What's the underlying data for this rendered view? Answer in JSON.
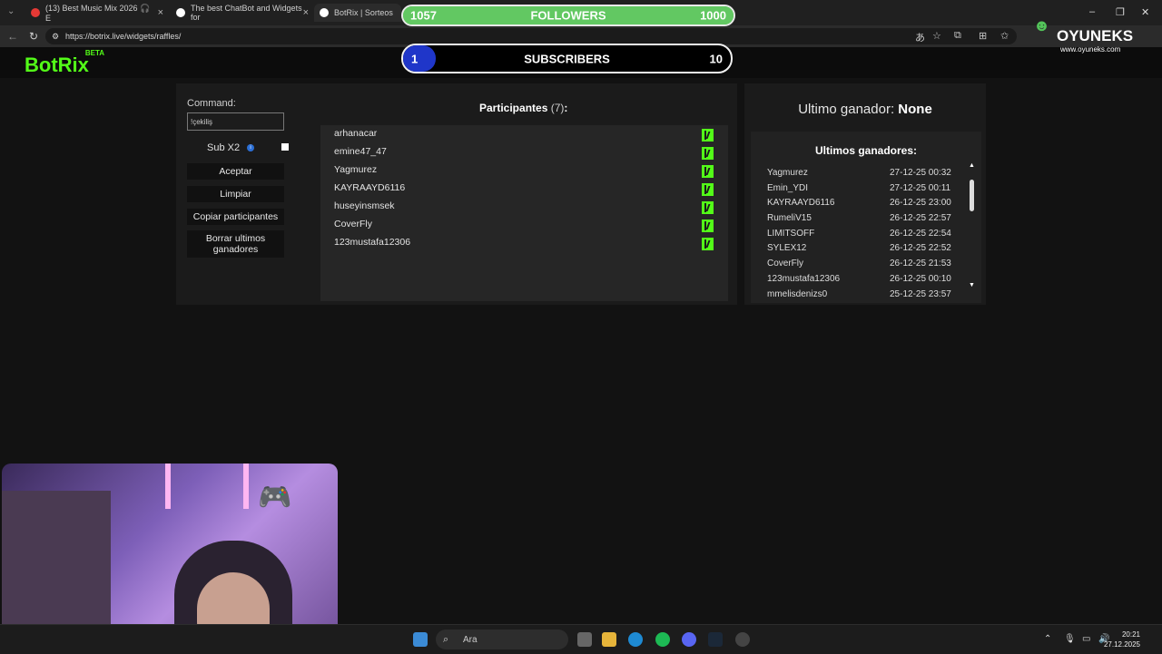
{
  "browser": {
    "tabs": [
      {
        "label": "(13) Best Music Mix 2026 🎧 E",
        "color": "#e53935"
      },
      {
        "label": "The best ChatBot and Widgets for",
        "color": "#ffffff"
      },
      {
        "label": "BotRix | Sorteos",
        "color": "#ffffff"
      }
    ],
    "url": "https://botrix.live/widgets/raffles/"
  },
  "overlay": {
    "followers": {
      "current": "1057",
      "label": "FOLLOWERS",
      "target": "1000",
      "progress": 1.0
    },
    "subscribers": {
      "current": "1",
      "label": "SUBSCRIBERS",
      "target": "10",
      "progress": 0.1
    },
    "watermark": "OYUNEKS",
    "watermark_url": "www.oyuneks.com"
  },
  "app": {
    "logo": "BotRix",
    "logo_badge": "BETA",
    "command_label": "Command:",
    "command_value": "!çekiliş",
    "sub_x2_label": "Sub X2",
    "buttons": {
      "accept": "Aceptar",
      "clear": "Limpiar",
      "copy": "Copiar participantes",
      "delete_winners": "Borrar ultimos ganadores"
    },
    "participants_title": "Participantes",
    "participants_count": "(7)",
    "participants": [
      "arhanacar",
      "emine47_47",
      "Yagmurez",
      "KAYRAAYD6116",
      "huseyinsmsek",
      "CoverFly",
      "123mustafa12306"
    ],
    "last_winner_label": "Ultimo ganador:",
    "last_winner_value": "None",
    "winners_title": "Ultimos ganadores:",
    "winners": [
      {
        "name": "Yagmurez",
        "date": "27-12-25 00:32"
      },
      {
        "name": "Emin_YDI",
        "date": "27-12-25 00:11"
      },
      {
        "name": "KAYRAAYD6116",
        "date": "26-12-25 23:00"
      },
      {
        "name": "RumeliV15",
        "date": "26-12-25 22:57"
      },
      {
        "name": "LIMITSOFF",
        "date": "26-12-25 22:54"
      },
      {
        "name": "SYLEX12",
        "date": "26-12-25 22:52"
      },
      {
        "name": "CoverFly",
        "date": "26-12-25 21:53"
      },
      {
        "name": "123mustafa12306",
        "date": "26-12-25 00:10"
      },
      {
        "name": "mmelisdenizs0",
        "date": "25-12-25 23:57"
      }
    ],
    "accent": "#53fc18"
  },
  "taskbar": {
    "search_placeholder": "Ara",
    "time": "20:21",
    "date": "27.12.2025"
  }
}
